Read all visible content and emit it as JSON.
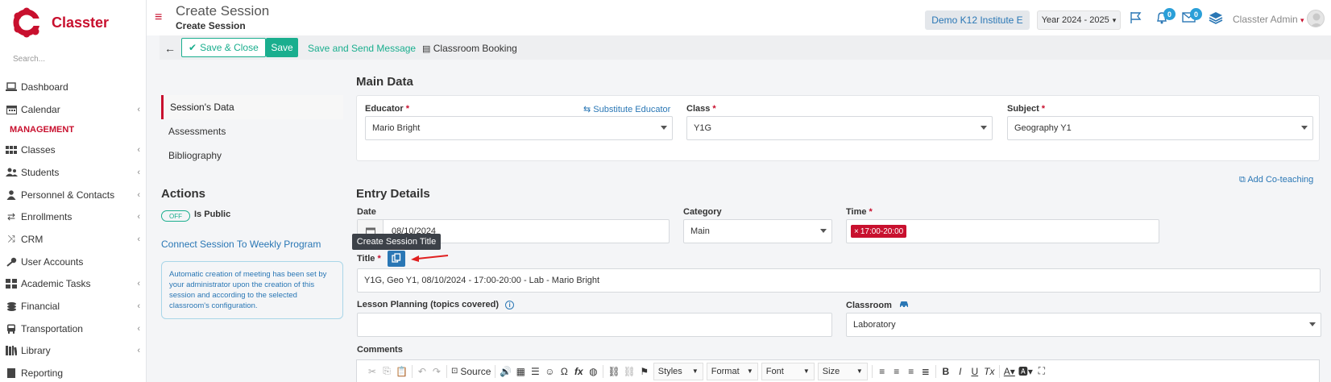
{
  "brand": {
    "name": "Classter",
    "accent": "#c8102e",
    "teal": "#1aae8e",
    "blue": "#2a77b5"
  },
  "search": {
    "placeholder": "Search..."
  },
  "sidebar": {
    "items": [
      {
        "label": "Dashboard",
        "icon": "laptop-icon"
      },
      {
        "label": "Calendar",
        "icon": "calendar-icon"
      }
    ],
    "section": "MANAGEMENT",
    "mgmt_items": [
      {
        "label": "Classes"
      },
      {
        "label": "Students"
      },
      {
        "label": "Personnel & Contacts"
      },
      {
        "label": "Enrollments"
      },
      {
        "label": "CRM"
      },
      {
        "label": "User Accounts"
      },
      {
        "label": "Academic Tasks"
      },
      {
        "label": "Financial"
      },
      {
        "label": "Transportation"
      },
      {
        "label": "Library"
      },
      {
        "label": "Reporting"
      }
    ]
  },
  "header": {
    "title": "Create Session",
    "subtitle": "Create Session",
    "institute": "Demo K12 Institute E",
    "year": "Year 2024 - 2025",
    "notifications": "0",
    "messages": "0",
    "user": "Classter Admin"
  },
  "toolbar": {
    "save_close": "Save & Close",
    "save": "Save",
    "save_send": "Save and Send Message",
    "booking": "Classroom Booking"
  },
  "tabs": [
    "Session's Data",
    "Assessments",
    "Bibliography"
  ],
  "actions": {
    "title": "Actions",
    "toggle": "OFF",
    "is_public": "Is Public",
    "connect": "Connect Session To Weekly Program",
    "info": "Automatic creation of meeting has been set by your administrator upon the creation of this session and according to the selected classroom's configuration."
  },
  "main_data": {
    "title": "Main Data",
    "educator_label": "Educator",
    "educator": "Mario Bright",
    "substitute": "Substitute Educator",
    "class_label": "Class",
    "class": "Y1G",
    "subject_label": "Subject",
    "subject": "Geography Y1"
  },
  "add_coteaching": "Add Co-teaching",
  "entry": {
    "title": "Entry Details",
    "date_label": "Date",
    "date": "08/10/2024",
    "category_label": "Category",
    "category": "Main",
    "time_label": "Time",
    "time": "17:00-20:00",
    "title_label": "Title",
    "tooltip": "Create Session Title",
    "session_title": "Y1G, Geo Y1, 08/10/2024 - 17:00-20:00 - Lab - Mario Bright",
    "lesson_label": "Lesson Planning (topics covered)",
    "classroom_label": "Classroom",
    "classroom": "Laboratory",
    "comments_label": "Comments"
  },
  "editor": {
    "source": "Source",
    "styles": "Styles",
    "format": "Format",
    "font": "Font",
    "size": "Size"
  }
}
